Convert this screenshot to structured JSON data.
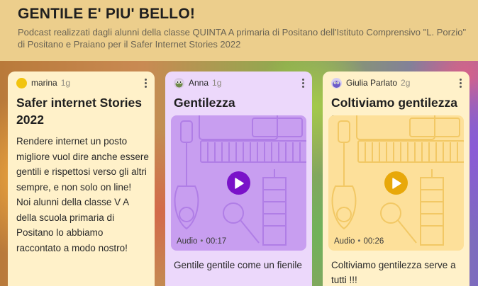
{
  "header": {
    "title": "GENTILE E' PIU' BELLO!",
    "subtitle": "Podcast realizzati dagli alunni della classe QUINTA A primaria di Positano dell'Istituto Comprensivo \"L. Porzio\" di Positano e Praiano per il Safer Internet Stories 2022"
  },
  "posts": [
    {
      "author": "marina",
      "time": "1g",
      "title": "Safer internet Stories 2022",
      "body": "Rendere internet un posto migliore vuol dire anche essere gentili e rispettosi verso gli altri sempre, e non solo on line!\nNoi alunni della classe V A della scuola primaria di Positano lo abbiamo raccontato a modo nostro!",
      "color": "#fff1c9",
      "avatar_color": "#f2c40f"
    },
    {
      "author": "Anna",
      "time": "1g",
      "title": "Gentilezza",
      "media_type": "Audio",
      "duration": "00:17",
      "caption": "Gentile gentile come un fienile",
      "color": "#ecd8fb",
      "accent": "#7a12c9",
      "avatar_icon": "bug-avatar-icon"
    },
    {
      "author": "Giulia Parlato",
      "time": "2g",
      "title": "Coltiviamo gentilezza !",
      "media_type": "Audio",
      "duration": "00:26",
      "caption": "Coltiviamo gentilezza serve a tutti !!!",
      "color": "#fff1c9",
      "accent": "#e8a80a",
      "avatar_icon": "monster-avatar-icon"
    }
  ]
}
